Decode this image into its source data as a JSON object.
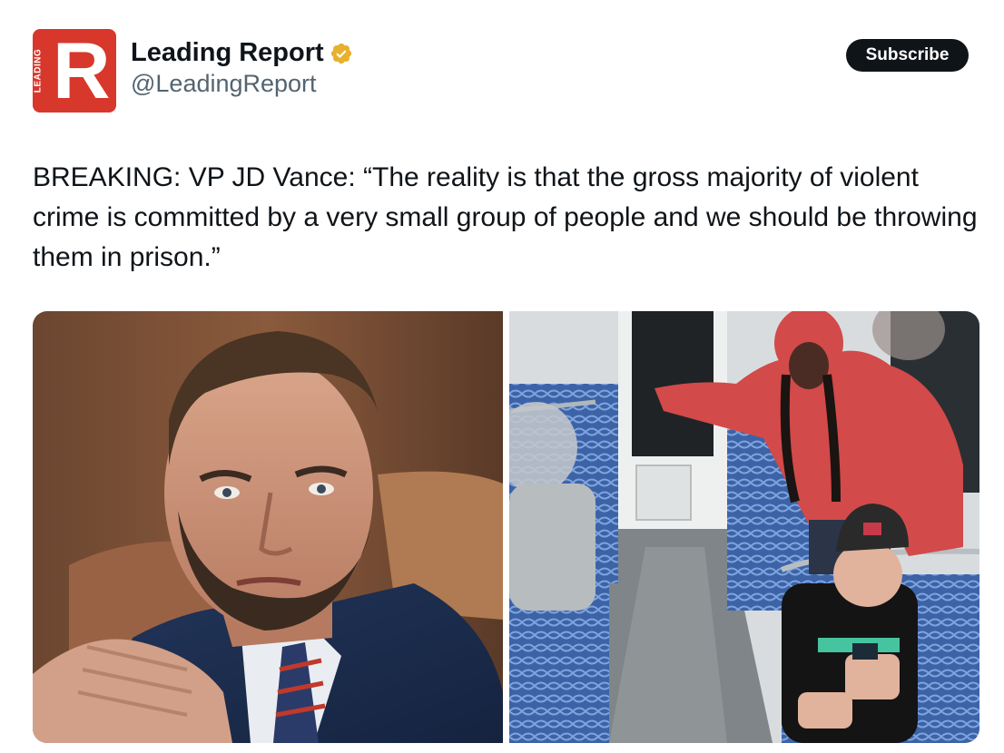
{
  "account": {
    "display_name": "Leading Report",
    "handle": "@LeadingReport",
    "verified_icon": "verified-badge-icon",
    "verified_color": "#e8b12b",
    "avatar": {
      "logo_letter": "R",
      "logo_vertical_text": "LEADING",
      "color": "#d8372b"
    }
  },
  "actions": {
    "subscribe_label": "Subscribe"
  },
  "post": {
    "text": "BREAKING: VP JD Vance: “The reality is that the gross majority of violent crime is committed by a very small group of people and we should be throwing them in prison.”"
  },
  "media": {
    "count": 2,
    "items": [
      {
        "kind": "photo",
        "subject": "portrait"
      },
      {
        "kind": "photo",
        "subject": "train-cctv"
      }
    ]
  },
  "theme": {
    "text_primary": "#0f1419",
    "text_secondary": "#536471",
    "button_bg": "#0f1419"
  }
}
